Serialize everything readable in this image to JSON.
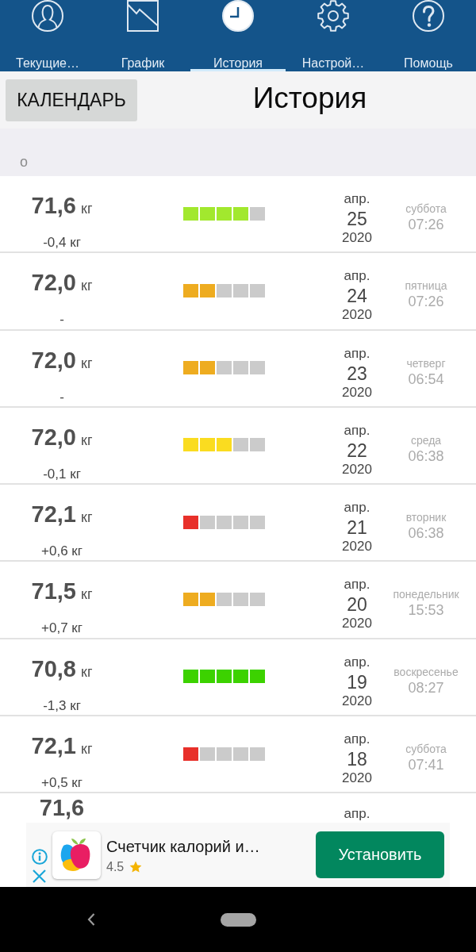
{
  "tabs": [
    {
      "label": "Текущие…",
      "selected": false
    },
    {
      "label": "График",
      "selected": false
    },
    {
      "label": "История",
      "selected": true
    },
    {
      "label": "Настрой…",
      "selected": false
    },
    {
      "label": "Помощь",
      "selected": false
    }
  ],
  "header": {
    "button": "КАЛЕНДАРЬ",
    "title": "История"
  },
  "section": {
    "label": "о"
  },
  "rows": [
    {
      "weight": "71,6",
      "unit": "кг",
      "change": "-0,4 кг",
      "level": 0.8,
      "color": "#a2e82e",
      "month": "апр.",
      "day": "25",
      "year": "2020",
      "weekday": "суббота",
      "time": "07:26"
    },
    {
      "weight": "72,0",
      "unit": "кг",
      "change": "-",
      "level": 0.4,
      "color": "#eeac20",
      "month": "апр.",
      "day": "24",
      "year": "2020",
      "weekday": "пятница",
      "time": "07:26"
    },
    {
      "weight": "72,0",
      "unit": "кг",
      "change": "-",
      "level": 0.4,
      "color": "#eeac20",
      "month": "апр.",
      "day": "23",
      "year": "2020",
      "weekday": "четверг",
      "time": "06:54"
    },
    {
      "weight": "72,0",
      "unit": "кг",
      "change": "-0,1 кг",
      "level": 0.6,
      "color": "#fadc20",
      "month": "апр.",
      "day": "22",
      "year": "2020",
      "weekday": "среда",
      "time": "06:38"
    },
    {
      "weight": "72,1",
      "unit": "кг",
      "change": "+0,6 кг",
      "level": 0.2,
      "color": "#e8302a",
      "month": "апр.",
      "day": "21",
      "year": "2020",
      "weekday": "вторник",
      "time": "06:38"
    },
    {
      "weight": "71,5",
      "unit": "кг",
      "change": "+0,7 кг",
      "level": 0.4,
      "color": "#eeac20",
      "month": "апр.",
      "day": "20",
      "year": "2020",
      "weekday": "понедельник",
      "time": "15:53"
    },
    {
      "weight": "70,8",
      "unit": "кг",
      "change": "-1,3 кг",
      "level": 1,
      "color": "#3cd200",
      "month": "апр.",
      "day": "19",
      "year": "2020",
      "weekday": "воскресенье",
      "time": "08:27"
    },
    {
      "weight": "72,1",
      "unit": "кг",
      "change": "+0,5 кг",
      "level": 0.2,
      "color": "#e8302a",
      "month": "апр.",
      "day": "18",
      "year": "2020",
      "weekday": "суббота",
      "time": "07:41"
    },
    {
      "weight": "71,6",
      "month": "апр."
    }
  ],
  "ad": {
    "title": "Счетчик калорий и…",
    "rating": "4.5",
    "button": "Установить"
  }
}
